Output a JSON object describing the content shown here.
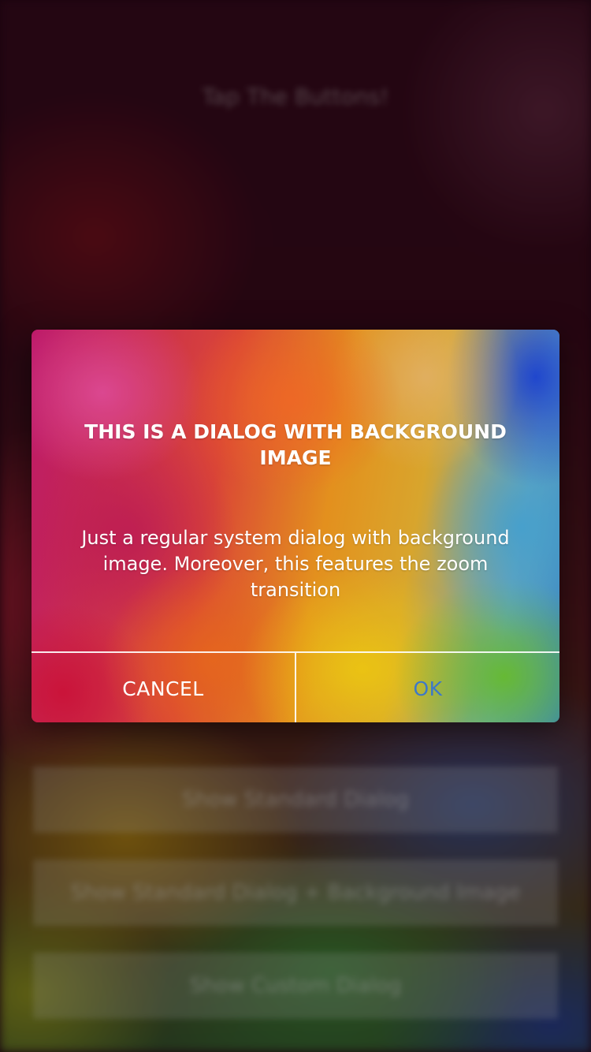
{
  "background_screen": {
    "title": "Tap The Buttons!",
    "buttons": [
      "Show Standard Dialog",
      "Show Standard Dialog + Background Image",
      "Show Custom Dialog"
    ]
  },
  "dialog": {
    "title": "THIS IS A DIALOG WITH BACKGROUND IMAGE",
    "message": "Just a regular system dialog with background image. Moreover, this features the zoom transition",
    "cancel_label": "CANCEL",
    "ok_label": "OK"
  },
  "colors": {
    "ok_text": "#3d78c8",
    "cancel_text": "#ffffff",
    "divider": "#ffffff"
  }
}
